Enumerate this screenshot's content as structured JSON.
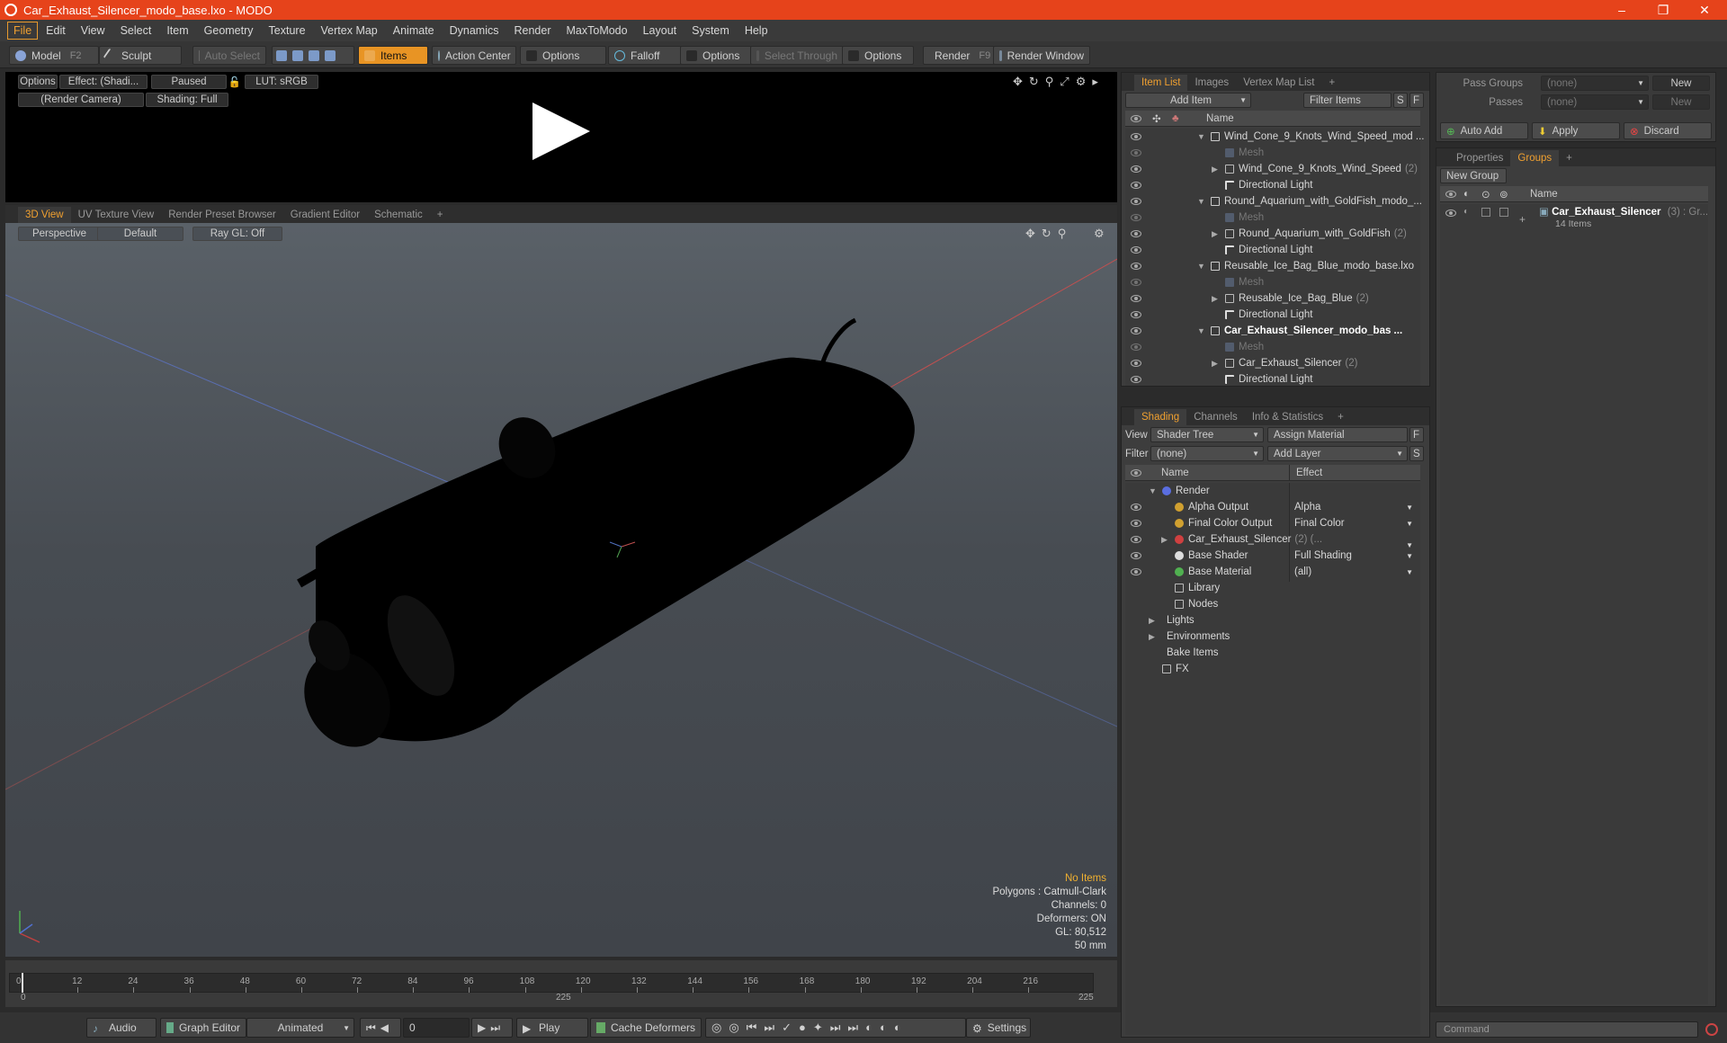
{
  "title": "Car_Exhaust_Silencer_modo_base.lxo - MODO",
  "window_controls": [
    "–",
    "❐",
    "✕"
  ],
  "menu": [
    "File",
    "Edit",
    "View",
    "Select",
    "Item",
    "Geometry",
    "Texture",
    "Vertex Map",
    "Animate",
    "Dynamics",
    "Render",
    "MaxToModo",
    "Layout",
    "System",
    "Help"
  ],
  "toolbar": {
    "model": "Model",
    "model_key": "F2",
    "sculpt": "Sculpt",
    "auto_select": "Auto Select",
    "items": "Items",
    "action_center": "Action Center",
    "options1": "Options",
    "falloff": "Falloff",
    "options2": "Options",
    "select_through": "Select Through",
    "options3": "Options",
    "render": "Render",
    "render_key": "F9",
    "render_window": "Render Window"
  },
  "preview": {
    "options": "Options",
    "effect": "Effect: (Shadi...",
    "paused": "Paused",
    "lut": "LUT: sRGB",
    "camera": "(Render Camera)",
    "shading": "Shading: Full"
  },
  "viewport_tabs": [
    "3D View",
    "UV Texture View",
    "Render Preset Browser",
    "Gradient Editor",
    "Schematic",
    "+"
  ],
  "viewport": {
    "perspective": "Perspective",
    "default": "Default",
    "raygl": "Ray GL: Off",
    "info": {
      "no_items": "No Items",
      "polygons": "Polygons : Catmull-Clark",
      "channels": "Channels: 0",
      "deformers": "Deformers: ON",
      "gl": "GL: 80,512",
      "focal": "50 mm"
    }
  },
  "timeline": {
    "ticks": [
      "0",
      "12",
      "24",
      "36",
      "48",
      "60",
      "72",
      "84",
      "96",
      "108",
      "120",
      "132",
      "144",
      "156",
      "168",
      "180",
      "192",
      "204",
      "216"
    ],
    "start": "0",
    "mid": "225",
    "end": "225"
  },
  "bottombar": {
    "audio": "Audio",
    "graph_editor": "Graph Editor",
    "animated": "Animated",
    "frame": "0",
    "play": "Play",
    "cache": "Cache Deformers",
    "settings": "Settings",
    "command_placeholder": "Command"
  },
  "item_list": {
    "tabs": [
      "Item List",
      "Images",
      "Vertex Map List",
      "+"
    ],
    "add_item": "Add Item",
    "filter": "Filter Items",
    "s": "S",
    "f": "F",
    "col_name": "Name",
    "rows": [
      {
        "label": "Wind_Cone_9_Knots_Wind_Speed_mod ...",
        "level": 0,
        "type": "scene",
        "count": ""
      },
      {
        "label": "Mesh",
        "level": 1,
        "type": "mesh",
        "count": ""
      },
      {
        "label": "Wind_Cone_9_Knots_Wind_Speed",
        "level": 1,
        "type": "group",
        "count": "(2)"
      },
      {
        "label": "Directional Light",
        "level": 1,
        "type": "light",
        "count": ""
      },
      {
        "label": "Round_Aquarium_with_GoldFish_modo_...",
        "level": 0,
        "type": "scene",
        "count": ""
      },
      {
        "label": "Mesh",
        "level": 1,
        "type": "mesh",
        "count": ""
      },
      {
        "label": "Round_Aquarium_with_GoldFish",
        "level": 1,
        "type": "group",
        "count": "(2)"
      },
      {
        "label": "Directional Light",
        "level": 1,
        "type": "light",
        "count": ""
      },
      {
        "label": "Reusable_Ice_Bag_Blue_modo_base.lxo",
        "level": 0,
        "type": "scene",
        "count": ""
      },
      {
        "label": "Mesh",
        "level": 1,
        "type": "mesh",
        "count": ""
      },
      {
        "label": "Reusable_Ice_Bag_Blue",
        "level": 1,
        "type": "group",
        "count": "(2)"
      },
      {
        "label": "Directional Light",
        "level": 1,
        "type": "light",
        "count": ""
      },
      {
        "label": "Car_Exhaust_Silencer_modo_bas ...",
        "level": 0,
        "type": "scene",
        "count": "",
        "bold": true
      },
      {
        "label": "Mesh",
        "level": 1,
        "type": "mesh",
        "count": ""
      },
      {
        "label": "Car_Exhaust_Silencer",
        "level": 1,
        "type": "group",
        "count": "(2)"
      },
      {
        "label": "Directional Light",
        "level": 1,
        "type": "light",
        "count": ""
      }
    ]
  },
  "shading": {
    "tabs": [
      "Shading",
      "Channels",
      "Info & Statistics",
      "+"
    ],
    "view_label": "View",
    "view_value": "Shader Tree",
    "assign_material": "Assign Material",
    "f": "F",
    "filter_label": "Filter",
    "filter_value": "(none)",
    "add_layer": "Add Layer",
    "s": "S",
    "col_name": "Name",
    "col_effect": "Effect",
    "rows": [
      {
        "label": "Render",
        "effect": "",
        "level": 0,
        "color": "#5a6ee0"
      },
      {
        "label": "Alpha Output",
        "effect": "Alpha",
        "level": 1,
        "color": "#d0a030"
      },
      {
        "label": "Final Color Output",
        "effect": "Final Color",
        "level": 1,
        "color": "#d0a030"
      },
      {
        "label": "Car_Exhaust_Silencer",
        "count": "(2) (...",
        "effect": "",
        "level": 1,
        "color": "#d04040"
      },
      {
        "label": "Base Shader",
        "effect": "Full Shading",
        "level": 1,
        "color": "#dddddd"
      },
      {
        "label": "Base Material",
        "effect": "(all)",
        "level": 1,
        "color": "#50b050"
      },
      {
        "label": "Library",
        "effect": "",
        "level": 1,
        "color": ""
      },
      {
        "label": "Nodes",
        "effect": "",
        "level": 1,
        "color": ""
      },
      {
        "label": "Lights",
        "effect": "",
        "level": 0,
        "color": ""
      },
      {
        "label": "Environments",
        "effect": "",
        "level": 0,
        "color": ""
      },
      {
        "label": "Bake Items",
        "effect": "",
        "level": 0,
        "color": ""
      },
      {
        "label": "FX",
        "effect": "",
        "level": 0,
        "color": ""
      }
    ]
  },
  "pass": {
    "pass_groups_label": "Pass Groups",
    "pass_groups_value": "(none)",
    "new1": "New",
    "passes_label": "Passes",
    "passes_value": "(none)",
    "new2": "New",
    "auto_add": "Auto Add",
    "apply": "Apply",
    "discard": "Discard"
  },
  "groups": {
    "tabs": [
      "Properties",
      "Groups",
      "+"
    ],
    "new_group": "New Group",
    "col_name": "Name",
    "item": "Car_Exhaust_Silencer",
    "item_count": "(3) : Gr...",
    "item_sub": "14 Items"
  }
}
